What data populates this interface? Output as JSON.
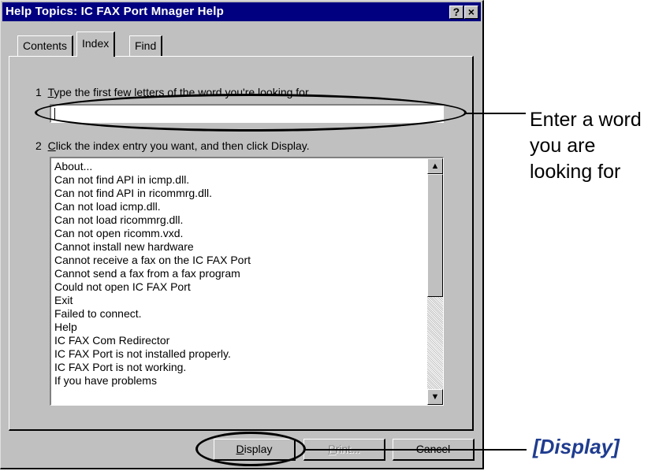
{
  "window": {
    "title": "Help Topics: IC FAX Port Mnager Help",
    "help_button": "?",
    "close_button": "×"
  },
  "tabs": [
    {
      "label": "Contents",
      "active": false
    },
    {
      "label": "Index",
      "active": true
    },
    {
      "label": "Find",
      "active": false
    }
  ],
  "step1": {
    "number": "1",
    "first_letter": "T",
    "rest": "ype the first few letters of the word you're looking for."
  },
  "search": {
    "value": "",
    "placeholder": ""
  },
  "step2": {
    "number": "2",
    "first_letter": "C",
    "rest": "lick the index entry you want, and then click Display."
  },
  "index_entries": [
    "About...",
    "Can not find API in icmp.dll.",
    "Can not find API in ricommrg.dll.",
    "Can not load icmp.dll.",
    "Can not load ricommrg.dll.",
    "Can not open ricomm.vxd.",
    "Cannot install new hardware",
    "Cannot receive a fax on the IC FAX Port",
    "Cannot send a fax from a fax program",
    "Could not open IC FAX Port",
    "Exit",
    "Failed to connect.",
    "Help",
    "IC FAX Com Redirector",
    "IC FAX Port is not installed properly.",
    "IC FAX Port is not working.",
    "If you have problems"
  ],
  "scrollbar": {
    "up": "▲",
    "down": "▼",
    "position": 0.0
  },
  "buttons": {
    "display": {
      "first_letter": "D",
      "rest": "isplay"
    },
    "print": {
      "first_letter": "P",
      "rest": "rint..."
    },
    "cancel": "Cancel"
  },
  "annotations": {
    "word_callout": [
      "Enter a word",
      "you are",
      "looking for"
    ],
    "display_callout": "[Display]",
    "callout_color": "#1f3c8f"
  }
}
